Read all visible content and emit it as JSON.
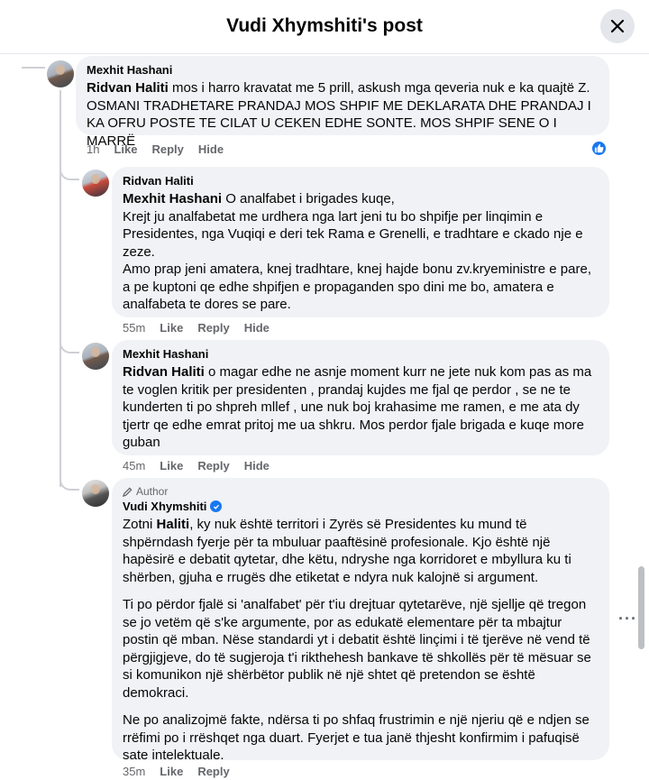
{
  "header": {
    "title": "Vudi Xhymshiti's post"
  },
  "comments": [
    {
      "author": "Mexhit Hashani",
      "mention": "Ridvan Haliti",
      "text": " mos i harro kravatat me 5 prill, askush mga qeveria nuk e ka quajtë Z. OSMANI TRADHETARE PRANDAJ MOS SHPIF ME DEKLARATA DHE PRANDAJ I KA OFRU POSTE TE CILAT U CEKEN EDHE SONTE. MOS SHPIF SENE O I MARRË",
      "time": "1h",
      "like": "Like",
      "reply": "Reply",
      "hide": "Hide",
      "reaction": "like"
    },
    {
      "author": "Ridvan Haliti",
      "mention": "Mexhit Hashani",
      "text": " O analfabet i brigades kuqe,",
      "para2": "Krejt ju analfabetat me urdhera nga lart jeni tu bo shpifje per linqimin e Presidentes, nga Vuqiqi e deri tek Rama e Grenelli, e tradhtare e ckado nje e zeze.",
      "para3": "Amo prap jeni amatera, knej tradhtare, knej hajde bonu zv.kryeministre e pare, a pe kuptoni qe edhe shpifjen e propaganden spo dini me bo, amatera e analfabeta te dores se pare.",
      "time": "55m",
      "like": "Like",
      "reply": "Reply",
      "hide": "Hide"
    },
    {
      "author": "Mexhit Hashani",
      "mention": "Ridvan Haliti",
      "text": " o magar edhe ne asnje moment kurr ne jete nuk kom pas as ma te voglen kritik per presidenten , prandaj kujdes me fjal qe perdor , se ne te kunderten ti po shpreh mllef , une nuk boj krahasime me ramen, e me ata dy tjertr qe edhe emrat pritoj me ua shkru. Mos perdor fjale brigada e kuqe more guban",
      "time": "45m",
      "like": "Like",
      "reply": "Reply",
      "hide": "Hide"
    },
    {
      "badge": "Author",
      "author": "Vudi Xhymshiti",
      "p1_pre": "Zotni ",
      "p1_bold": "Haliti",
      "p1_post": ", ky nuk është territori i Zyrës së Presidentes ku mund të shpërndash fyerje për ta mbuluar paaftësinë profesionale. Kjo është një hapësirë e debatit qytetar, dhe këtu, ndryshe nga korridoret e mbyllura ku ti shërben, gjuha e rrugës dhe etiketat e ndyra nuk kalojnë si argument.",
      "p2": "Ti po përdor fjalë si 'analfabet' për t'iu drejtuar qytetarëve, një sjellje që tregon se jo vetëm që s'ke argumente, por as edukatë elementare për ta mbajtur postin që mban. Nëse standardi yt i debatit është linçimi i të tjerëve në vend të përgjigjeve, do të sugjeroja t'i rikthehesh bankave të shkollës për të mësuar se si komunikon një shërbëtor publik në një shtet që pretendon se është demokraci.",
      "p3": "Ne po analizojmë fakte, ndërsa ti po shfaq frustrimin e një njeriu që e ndjen se rrëfimi po i rrëshqet nga duart. Fyerjet e tua janë thjesht konfirmim i pafuqisë sate intelektuale.",
      "time": "35m",
      "like": "Like",
      "reply": "Reply"
    }
  ],
  "icons": {
    "close": "close-icon",
    "more": "more-options-icon",
    "verified": "verified-badge-icon",
    "author": "pencil-icon",
    "reaction": "thumbs-up-icon"
  },
  "colors": {
    "accent": "#1877f2",
    "bubble": "#f0f2f5",
    "secondary_text": "#65676b"
  }
}
